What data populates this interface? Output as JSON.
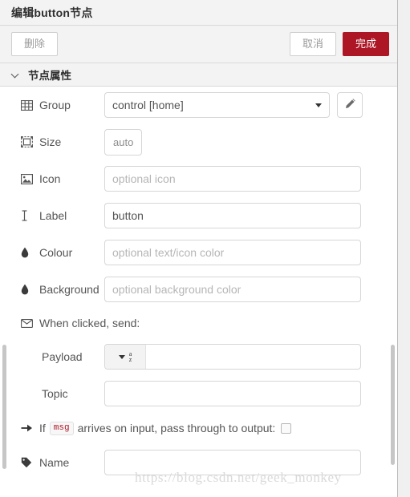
{
  "dialog": {
    "title": "编辑button节点"
  },
  "toolbar": {
    "delete_label": "删除",
    "cancel_label": "取消",
    "done_label": "完成",
    "done_color": "#ad1625"
  },
  "section": {
    "title": "节点属性"
  },
  "form": {
    "group": {
      "label": "Group",
      "icon": "table-icon",
      "value": "control [home]",
      "edit_icon": "pencil-icon"
    },
    "size": {
      "label": "Size",
      "icon": "object-group-icon",
      "value": "auto"
    },
    "icon": {
      "label": "Icon",
      "icon": "image-icon",
      "value": "",
      "placeholder": "optional icon"
    },
    "text_label": {
      "label": "Label",
      "icon": "i-beam-icon",
      "value": "button",
      "placeholder": ""
    },
    "colour": {
      "label": "Colour",
      "icon": "tint-icon",
      "value": "",
      "placeholder": "optional text/icon color"
    },
    "background": {
      "label": "Background",
      "icon": "tint-icon",
      "value": "",
      "placeholder": "optional background color"
    },
    "when_clicked": {
      "label": "When clicked, send:",
      "icon": "envelope-icon"
    },
    "payload": {
      "label": "Payload",
      "type_icon": "az-string-type-icon",
      "value": "",
      "placeholder": ""
    },
    "topic": {
      "label": "Topic",
      "value": "",
      "placeholder": ""
    },
    "passthrough": {
      "icon": "arrow-right-icon",
      "prefix": "If",
      "code": "msg",
      "suffix": "arrives on input, pass through to output:",
      "checked": false
    },
    "name": {
      "label": "Name",
      "icon": "tag-icon",
      "value": "",
      "placeholder": ""
    }
  },
  "watermark": {
    "text": "https://blog.csdn.net/geek_monkey"
  }
}
